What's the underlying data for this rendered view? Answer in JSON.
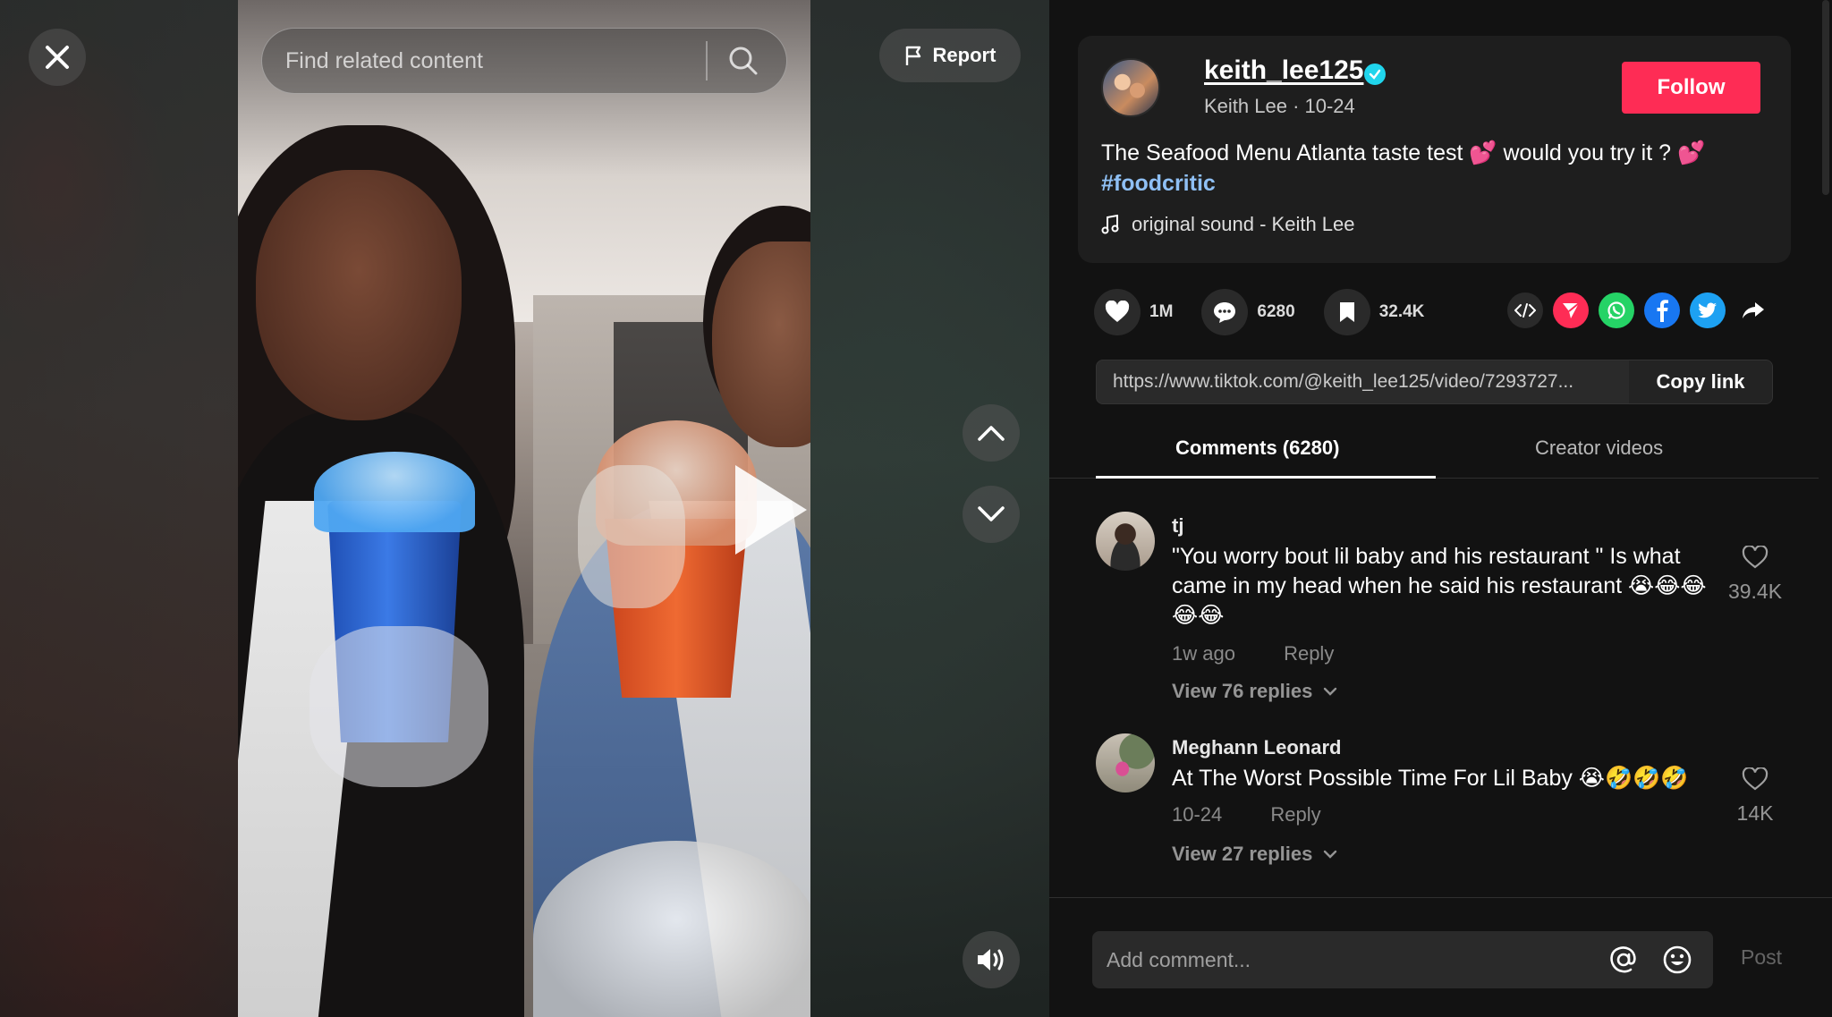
{
  "video": {
    "search_placeholder": "Find related content",
    "report_label": "Report"
  },
  "author": {
    "username": "keith_lee125",
    "display_name": "Keith Lee",
    "date": "10-24",
    "byline": "Keith Lee · 10-24",
    "follow_label": "Follow"
  },
  "description": {
    "caption": "The Seafood Menu Atlanta taste test 💕 would you try it ? 💕",
    "hashtag": "#foodcritic",
    "sound": "original sound - Keith Lee"
  },
  "stats": {
    "likes": "1M",
    "comments": "6280",
    "saves": "32.4K"
  },
  "share": {
    "link": "https://www.tiktok.com/@keith_lee125/video/7293727...",
    "copy_label": "Copy link",
    "icons": [
      "embed-icon",
      "send-icon",
      "whatsapp-icon",
      "facebook-icon",
      "twitter-icon",
      "share-arrow-icon"
    ]
  },
  "tabs": [
    {
      "label": "Comments (6280)",
      "active": true
    },
    {
      "label": "Creator videos",
      "active": false
    }
  ],
  "comments": [
    {
      "name": "tj",
      "text": "\"You worry bout lil baby and his restaurant \" Is what came in my head when he said his restaurant 😭😂😂😂😂",
      "time": "1w ago",
      "reply_label": "Reply",
      "view_replies": "View 76 replies",
      "likes": "39.4K"
    },
    {
      "name": "Meghann Leonard",
      "text": "At The Worst Possible Time For Lil Baby 😭🤣🤣🤣",
      "time": "10-24",
      "reply_label": "Reply",
      "view_replies": "View 27 replies",
      "likes": "14K"
    }
  ],
  "composer": {
    "placeholder": "Add comment...",
    "post_label": "Post"
  },
  "colors": {
    "follow": "#fe2c55",
    "hashtag": "#8fc0f5",
    "panel_bg": "#121212",
    "verified": "#20d5ec"
  }
}
